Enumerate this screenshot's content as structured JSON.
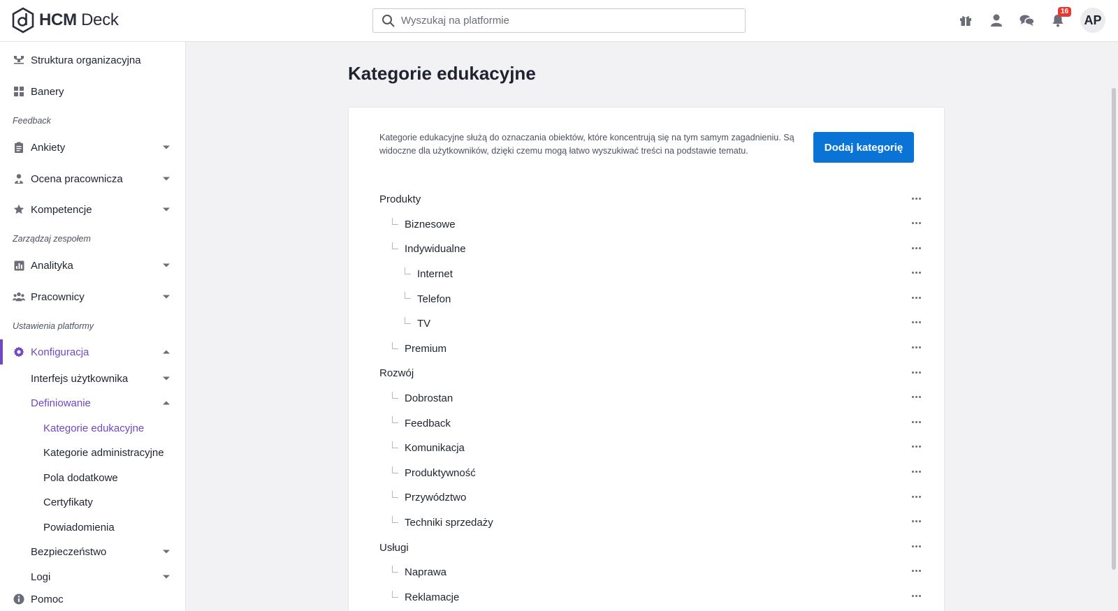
{
  "header": {
    "logo_text_bold": "HCM",
    "logo_text_light": " Deck",
    "search_placeholder": "Wyszukaj na platformie",
    "notification_count": "16",
    "avatar_initials": "AP"
  },
  "sidebar": {
    "item_struktura": "Struktura organizacyjna",
    "item_banery": "Banery",
    "section_feedback": "Feedback",
    "item_ankiety": "Ankiety",
    "item_ocena": "Ocena pracownicza",
    "item_kompetencje": "Kompetencje",
    "section_zarzadzaj": "Zarządzaj zespołem",
    "item_analityka": "Analityka",
    "item_pracownicy": "Pracownicy",
    "section_ustawienia": "Ustawienia platformy",
    "item_konfiguracja": "Konfiguracja",
    "sub_interfejs": "Interfejs użytkownika",
    "sub_definiowanie": "Definiowanie",
    "sub_kategorie_edu": "Kategorie edukacyjne",
    "sub_kategorie_adm": "Kategorie administracyjne",
    "sub_pola": "Pola dodatkowe",
    "sub_certyfikaty": "Certyfikaty",
    "sub_powiadomienia": "Powiadomienia",
    "sub_bezpieczenstwo": "Bezpieczeństwo",
    "sub_logi": "Logi",
    "item_pomoc": "Pomoc"
  },
  "main": {
    "title": "Kategorie edukacyjne",
    "description": "Kategorie edukacyjne służą do oznaczania obiektów, które koncentrują się na tym samym zagadnieniu. Są widoczne dla użytkowników, dzięki czemu mogą łatwo wyszukiwać treści na podstawie tematu.",
    "add_button": "Dodaj kategorię",
    "categories": [
      {
        "label": "Produkty",
        "level": 0
      },
      {
        "label": "Biznesowe",
        "level": 1
      },
      {
        "label": "Indywidualne",
        "level": 1
      },
      {
        "label": "Internet",
        "level": 2
      },
      {
        "label": "Telefon",
        "level": 2
      },
      {
        "label": "TV",
        "level": 2
      },
      {
        "label": "Premium",
        "level": 1
      },
      {
        "label": "Rozwój",
        "level": 0
      },
      {
        "label": "Dobrostan",
        "level": 1
      },
      {
        "label": "Feedback",
        "level": 1
      },
      {
        "label": "Komunikacja",
        "level": 1
      },
      {
        "label": "Produktywność",
        "level": 1
      },
      {
        "label": "Przywództwo",
        "level": 1
      },
      {
        "label": "Techniki sprzedaży",
        "level": 1
      },
      {
        "label": "Usługi",
        "level": 0
      },
      {
        "label": "Naprawa",
        "level": 1
      },
      {
        "label": "Reklamacje",
        "level": 1
      }
    ]
  },
  "colors": {
    "accent_purple": "#7048c2",
    "primary_blue": "#0a74d6",
    "badge_red": "#e53935"
  }
}
